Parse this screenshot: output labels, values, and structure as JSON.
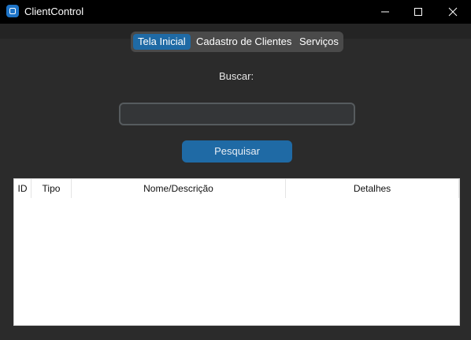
{
  "window": {
    "title": "ClientControl"
  },
  "tabs": [
    {
      "label": "Tela Inicial"
    },
    {
      "label": "Cadastro de Clientes"
    },
    {
      "label": "Serviços"
    }
  ],
  "search": {
    "label": "Buscar:",
    "value": "",
    "button": "Pesquisar"
  },
  "table": {
    "columns": [
      "ID",
      "Tipo",
      "Nome/Descrição",
      "Detalhes"
    ],
    "rows": []
  },
  "colors": {
    "accent": "#1f6aa5",
    "background": "#2b2b2b",
    "titlebar": "#000000"
  }
}
